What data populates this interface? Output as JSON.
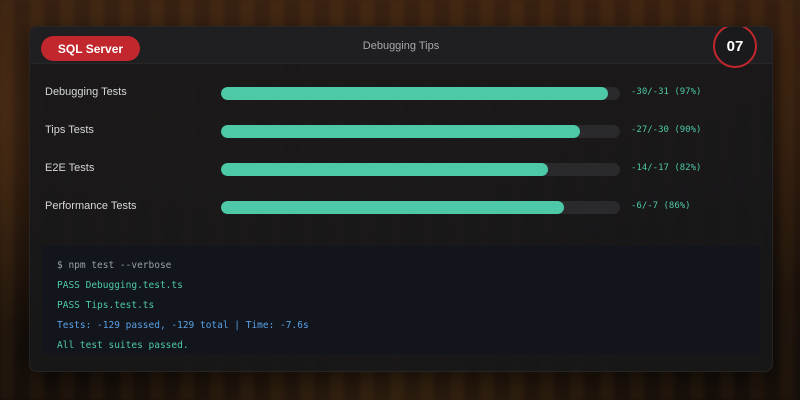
{
  "header": {
    "server_label": "SQL Server",
    "title": "Debugging Tips",
    "step_number": "07"
  },
  "tests": [
    {
      "label": "Debugging Tests",
      "stat": "-30/-31 (97%)",
      "progress": 0.97
    },
    {
      "label": "Tips Tests",
      "stat": "-27/-30 (90%)",
      "progress": 0.9
    },
    {
      "label": "E2E Tests",
      "stat": "-14/-17 (82%)",
      "progress": 0.82
    },
    {
      "label": "Performance Tests",
      "stat": "-6/-7 (86%)",
      "progress": 0.86
    }
  ],
  "terminal": {
    "lines": [
      {
        "text": "$ npm test --verbose",
        "color": "#9aa0a6"
      },
      {
        "text": "PASS Debugging.test.ts",
        "color": "#4ec9a8"
      },
      {
        "text": "PASS Tips.test.ts",
        "color": "#4ec9a8"
      },
      {
        "text": "Tests: -129 passed, -129 total | Time: -7.6s",
        "color": "#5aa0e6"
      },
      {
        "text": "All test suites passed.",
        "color": "#4ec9a8"
      }
    ]
  },
  "colors": {
    "accent_red": "#c1272d",
    "bar_green": "#4ec9a8",
    "info_blue": "#5aa0e6"
  }
}
